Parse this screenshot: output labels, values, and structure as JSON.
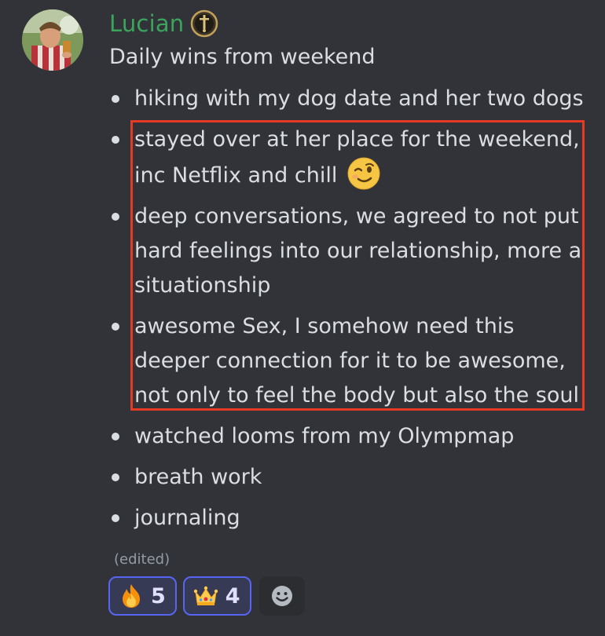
{
  "message": {
    "username": "Lucian",
    "username_color": "#3ba55c",
    "badge_icon": "sword-badge-icon",
    "title": "Daily wins from weekend",
    "items": [
      {
        "text": "hiking with my dog date and her two dogs"
      },
      {
        "text": "stayed over at her place for the weekend, inc Netflix and chill",
        "emoji": "winking-face-emoji"
      },
      {
        "text": "deep conversations, we agreed to not put hard feelings into our relationship, more a situationship"
      },
      {
        "text": "awesome Sex, I somehow need this deeper connection for it to be awesome, not only to feel the body but also the soul"
      },
      {
        "text": "watched looms from my Olympmap"
      },
      {
        "text": "breath work"
      },
      {
        "text": "journaling"
      }
    ],
    "edited_label": "(edited)"
  },
  "reactions": [
    {
      "emoji": "fire-emoji",
      "count": "5"
    },
    {
      "emoji": "crown-emoji",
      "count": "4"
    }
  ],
  "highlight_color": "#e53a23",
  "add_reaction_icon": "smiley-add-reaction-icon"
}
